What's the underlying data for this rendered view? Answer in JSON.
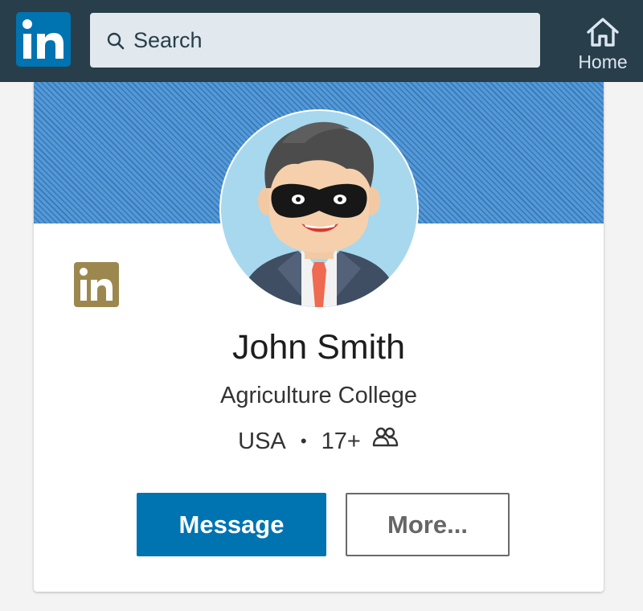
{
  "topbar": {
    "search_placeholder": "Search",
    "home_label": "Home",
    "logo_icon": "linkedin-logo-icon"
  },
  "profile": {
    "name": "John Smith",
    "headline": "Agriculture College",
    "location": "USA",
    "separator": "•",
    "connections": "17+",
    "avatar_icon": "masked-businessman-avatar",
    "school_logo_icon": "linkedin-logo-gold-icon"
  },
  "actions": {
    "message_label": "Message",
    "more_label": "More..."
  },
  "colors": {
    "topbar": "#283e4a",
    "brand_blue": "#0073b1",
    "search_bg": "#e1e9ee",
    "banner": "#4a8fd0",
    "school_logo": "#9c884f"
  }
}
